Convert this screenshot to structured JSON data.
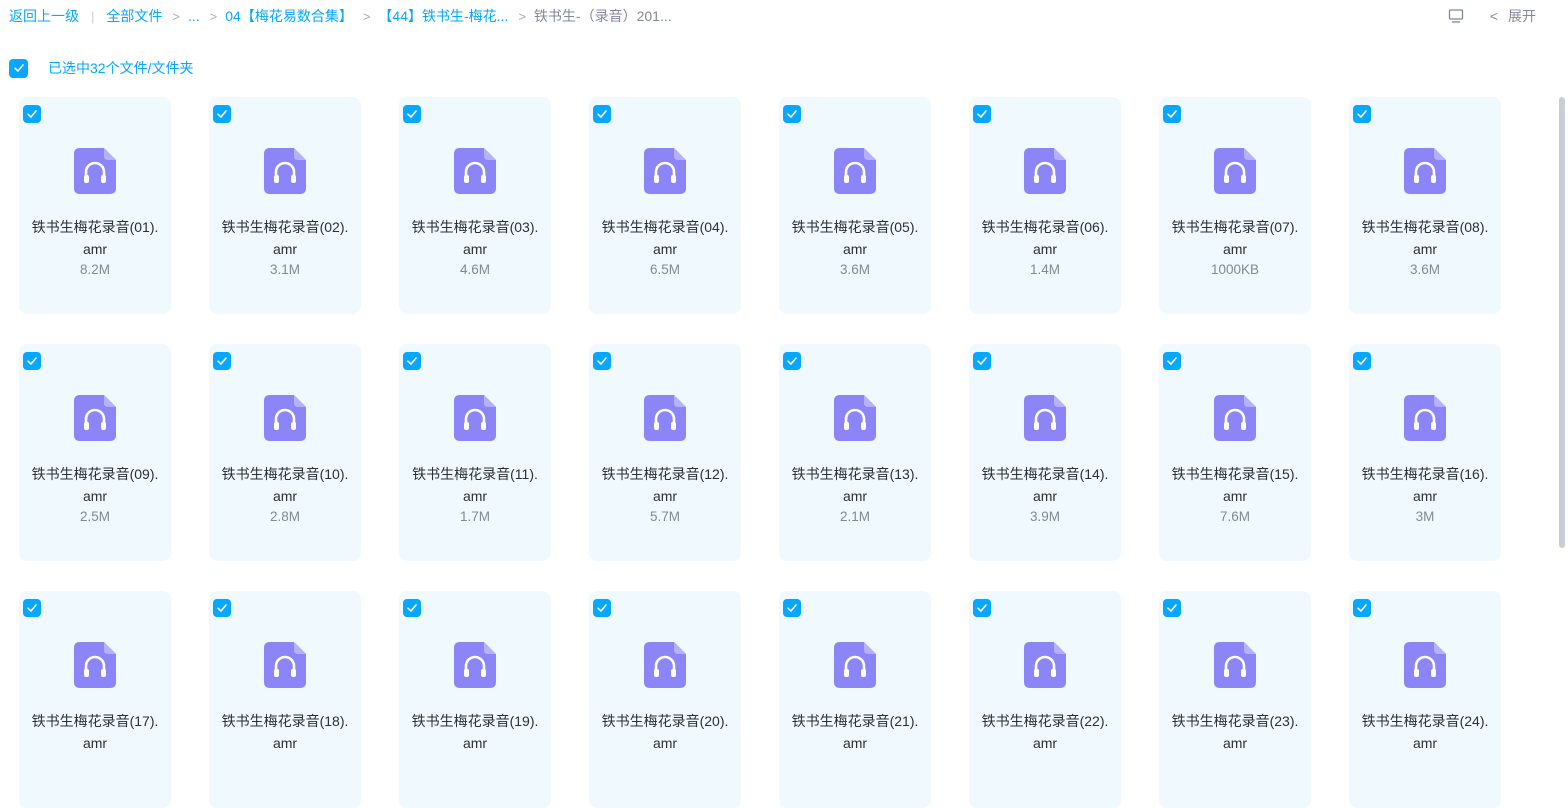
{
  "breadcrumb": {
    "back": "返回上一级",
    "all_files": "全部文件",
    "ellipsis": "...",
    "item1": "04【梅花易数合集】",
    "item2": "【44】铁书生-梅花...",
    "current": "铁书生-（录音）201..."
  },
  "toolbar": {
    "expand_label": "展开"
  },
  "selection": {
    "label": "已选中32个文件/文件夹"
  },
  "colors": {
    "accent": "#06a7ff",
    "card_bg": "#f0f9fe",
    "icon": "#8b85f7"
  },
  "files": [
    {
      "name": "铁书生梅花录音(01).amr",
      "size": "8.2M"
    },
    {
      "name": "铁书生梅花录音(02).amr",
      "size": "3.1M"
    },
    {
      "name": "铁书生梅花录音(03).amr",
      "size": "4.6M"
    },
    {
      "name": "铁书生梅花录音(04).amr",
      "size": "6.5M"
    },
    {
      "name": "铁书生梅花录音(05).amr",
      "size": "3.6M"
    },
    {
      "name": "铁书生梅花录音(06).amr",
      "size": "1.4M"
    },
    {
      "name": "铁书生梅花录音(07).amr",
      "size": "1000KB"
    },
    {
      "name": "铁书生梅花录音(08).amr",
      "size": "3.6M"
    },
    {
      "name": "铁书生梅花录音(09).amr",
      "size": "2.5M"
    },
    {
      "name": "铁书生梅花录音(10).amr",
      "size": "2.8M"
    },
    {
      "name": "铁书生梅花录音(11).amr",
      "size": "1.7M"
    },
    {
      "name": "铁书生梅花录音(12).amr",
      "size": "5.7M"
    },
    {
      "name": "铁书生梅花录音(13).amr",
      "size": "2.1M"
    },
    {
      "name": "铁书生梅花录音(14).amr",
      "size": "3.9M"
    },
    {
      "name": "铁书生梅花录音(15).amr",
      "size": "7.6M"
    },
    {
      "name": "铁书生梅花录音(16).amr",
      "size": "3M"
    },
    {
      "name": "铁书生梅花录音(17).amr",
      "size": ""
    },
    {
      "name": "铁书生梅花录音(18).amr",
      "size": ""
    },
    {
      "name": "铁书生梅花录音(19).amr",
      "size": ""
    },
    {
      "name": "铁书生梅花录音(20).amr",
      "size": ""
    },
    {
      "name": "铁书生梅花录音(21).amr",
      "size": ""
    },
    {
      "name": "铁书生梅花录音(22).amr",
      "size": ""
    },
    {
      "name": "铁书生梅花录音(23).amr",
      "size": ""
    },
    {
      "name": "铁书生梅花录音(24).amr",
      "size": ""
    }
  ]
}
